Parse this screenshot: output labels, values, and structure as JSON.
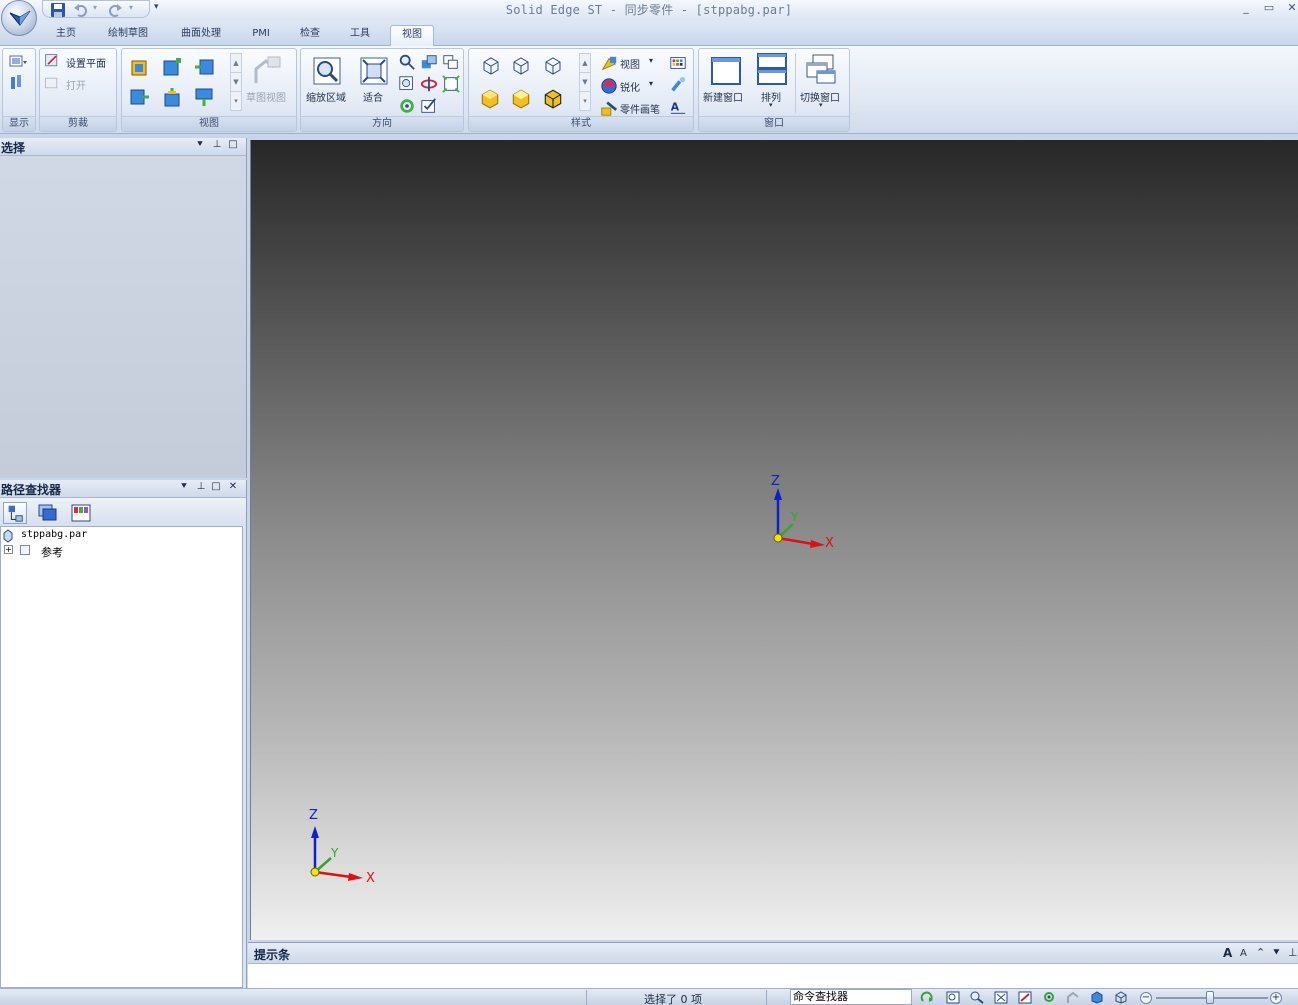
{
  "window": {
    "title": "Solid Edge ST - 同步零件 - [stppabg.par]",
    "controls": {
      "minimize": "_",
      "maximize": "▭",
      "close": "✕"
    },
    "mdi_controls": {
      "minimize": "–",
      "restore": "❐",
      "close": "✕"
    }
  },
  "ribbon": {
    "tabs": [
      "主页",
      "绘制草图",
      "曲面处理",
      "PMI",
      "检查",
      "工具",
      "视图"
    ],
    "active_tab": "视图",
    "groups": {
      "display": {
        "label": "显示"
      },
      "clip": {
        "label": "剪裁",
        "set_plane": "设置平面",
        "open": "打开"
      },
      "view": {
        "label": "视图",
        "sketch_view": "草图视图"
      },
      "orient": {
        "label": "方向",
        "zoom_area": "缩放区域",
        "fit": "适合"
      },
      "style": {
        "label": "样式",
        "view_style": "视图",
        "sharpen": "锐化",
        "part_painter": "零件画笔"
      },
      "window": {
        "label": "窗口",
        "new_window": "新建窗口",
        "arrange": "排列",
        "switch_window": "切换窗口"
      }
    }
  },
  "select_pane": {
    "title": "选择"
  },
  "path_finder": {
    "title": "路径查找器",
    "tree": [
      {
        "label": "stppabg.par",
        "icon": "part-icon"
      },
      {
        "label": "参考",
        "icon": "reference-planes-icon",
        "expander": "+"
      }
    ]
  },
  "viewport": {
    "axis_labels": {
      "x": "X",
      "y": "Y",
      "z": "Z"
    }
  },
  "prompt_bar": {
    "title": "提示条",
    "font_increase": "A",
    "font_decrease": "A"
  },
  "status_bar": {
    "selection_text": "选择了 0 项",
    "command_finder": "命令查找器"
  },
  "colors": {
    "axis_x": "#e01010",
    "axis_y": "#2ea82e",
    "axis_z": "#1020c8",
    "origin": "#f2e600",
    "ribbon_bg": "#dde6f2"
  }
}
